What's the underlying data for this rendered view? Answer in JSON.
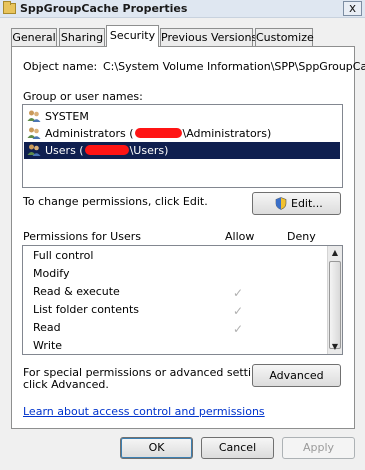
{
  "window": {
    "title": "SppGroupCache Properties",
    "close_glyph": "x"
  },
  "tabs": [
    {
      "label": "General"
    },
    {
      "label": "Sharing"
    },
    {
      "label": "Security"
    },
    {
      "label": "Previous Versions"
    },
    {
      "label": "Customize"
    }
  ],
  "object": {
    "label": "Object name:",
    "value": "C:\\System Volume Information\\SPP\\SppGroupCac"
  },
  "groups": {
    "label": "Group or user names:",
    "items": [
      {
        "name": "SYSTEM",
        "prefix": "",
        "suffix": ""
      },
      {
        "name": "Administrators",
        "prefix": "Administrators (",
        "suffix": "\\Administrators)"
      },
      {
        "name": "Users",
        "prefix": "Users (",
        "suffix": "\\Users)"
      }
    ],
    "selected_index": 2
  },
  "change_hint": "To change permissions, click Edit.",
  "edit_button": "Edit...",
  "permissions": {
    "title": "Permissions for Users",
    "col_allow": "Allow",
    "col_deny": "Deny",
    "rows": [
      {
        "name": "Full control",
        "allow": false,
        "deny": false
      },
      {
        "name": "Modify",
        "allow": false,
        "deny": false
      },
      {
        "name": "Read & execute",
        "allow": true,
        "deny": false
      },
      {
        "name": "List folder contents",
        "allow": true,
        "deny": false
      },
      {
        "name": "Read",
        "allow": true,
        "deny": false
      },
      {
        "name": "Write",
        "allow": false,
        "deny": false
      }
    ]
  },
  "advanced": {
    "text_line1": "For special permissions or advanced settings,",
    "text_line2": "click Advanced.",
    "button": "Advanced"
  },
  "help_link": "Learn about access control and permissions",
  "footer": {
    "ok": "OK",
    "cancel": "Cancel",
    "apply": "Apply"
  },
  "colors": {
    "selection": "#0f1f4f",
    "link": "#0033cc",
    "redaction": "#ff1414"
  }
}
